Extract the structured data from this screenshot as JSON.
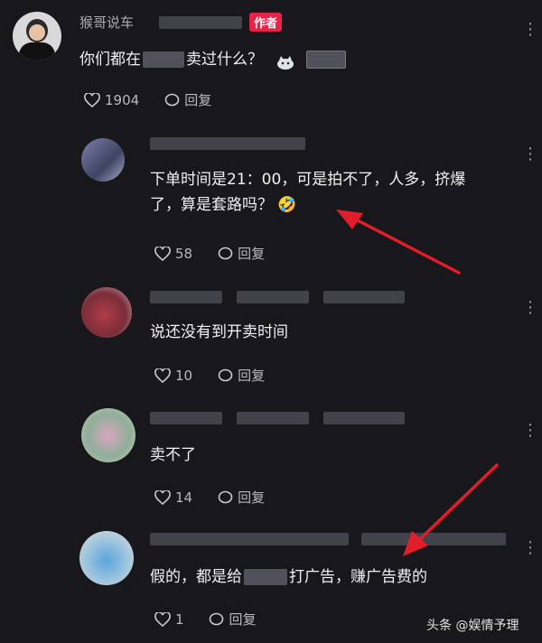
{
  "author": {
    "name": "猴哥说车",
    "badge": "作者",
    "text_before": "你们都在",
    "text_after": "卖过什么？",
    "likes": "1904",
    "reply": "回复"
  },
  "comments": [
    {
      "text_line1": "下单时间是21：00，可是拍不了，人多，挤爆",
      "text_line2": "了，算是套路吗？",
      "emoji": "🤣",
      "likes": "58",
      "reply": "回复"
    },
    {
      "text": "说还没有到开卖时间",
      "likes": "10",
      "reply": "回复"
    },
    {
      "text": "卖不了",
      "likes": "14",
      "reply": "回复"
    },
    {
      "text_before": "假的，都是给",
      "text_after": "打广告，赚广告费的",
      "likes": "1",
      "reply": "回复"
    }
  ],
  "watermark": {
    "brand": "头条",
    "handle": "@娱情予理"
  },
  "colors": {
    "accent_red": "#e11d2a",
    "badge": "#e8234a",
    "bg": "#17171c"
  }
}
